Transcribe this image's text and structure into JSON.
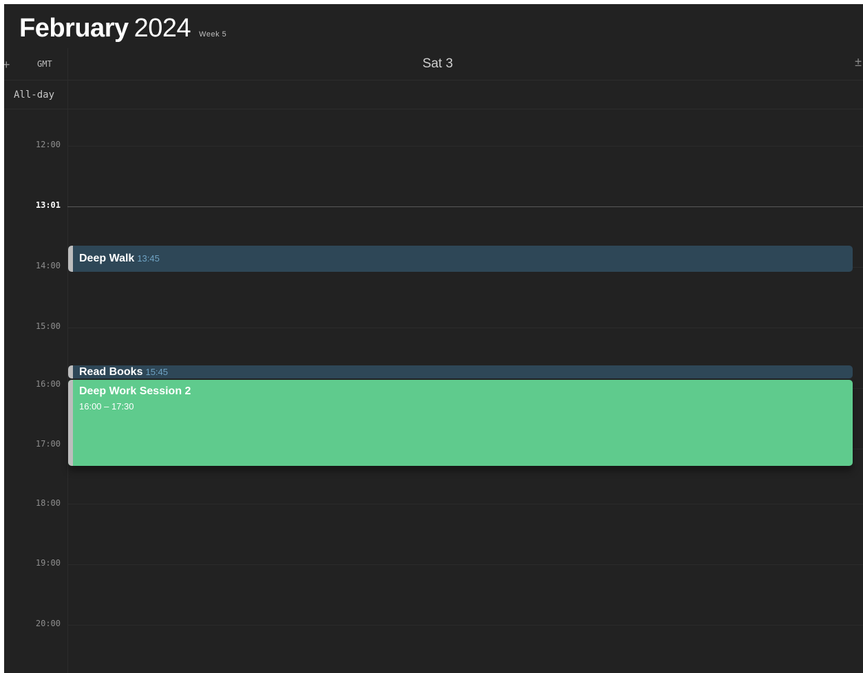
{
  "header": {
    "month": "February",
    "year": "2024",
    "week": "Week 5"
  },
  "dayrow": {
    "add_left": "+",
    "timezone": "GMT",
    "day": "Sat 3",
    "add_right": "±"
  },
  "allday": {
    "label": "All-day"
  },
  "times": {
    "h12": "12:00",
    "now": "13:01",
    "h14": "14:00",
    "h15": "15:00",
    "h16": "16:00",
    "h17": "17:00",
    "h18": "18:00",
    "h19": "19:00",
    "h20": "20:00"
  },
  "events": {
    "deep_walk": {
      "title": "Deep Walk",
      "time": "13:45"
    },
    "read_books": {
      "title": "Read Books",
      "time": "15:45"
    },
    "deep_work": {
      "title": "Deep Work Session 2",
      "time": "16:00 – 17:30"
    }
  },
  "colors": {
    "background": "#222222",
    "event_blue": "#2e4757",
    "event_green": "#5fcb8d",
    "event_bar": "#bdbdbd"
  }
}
